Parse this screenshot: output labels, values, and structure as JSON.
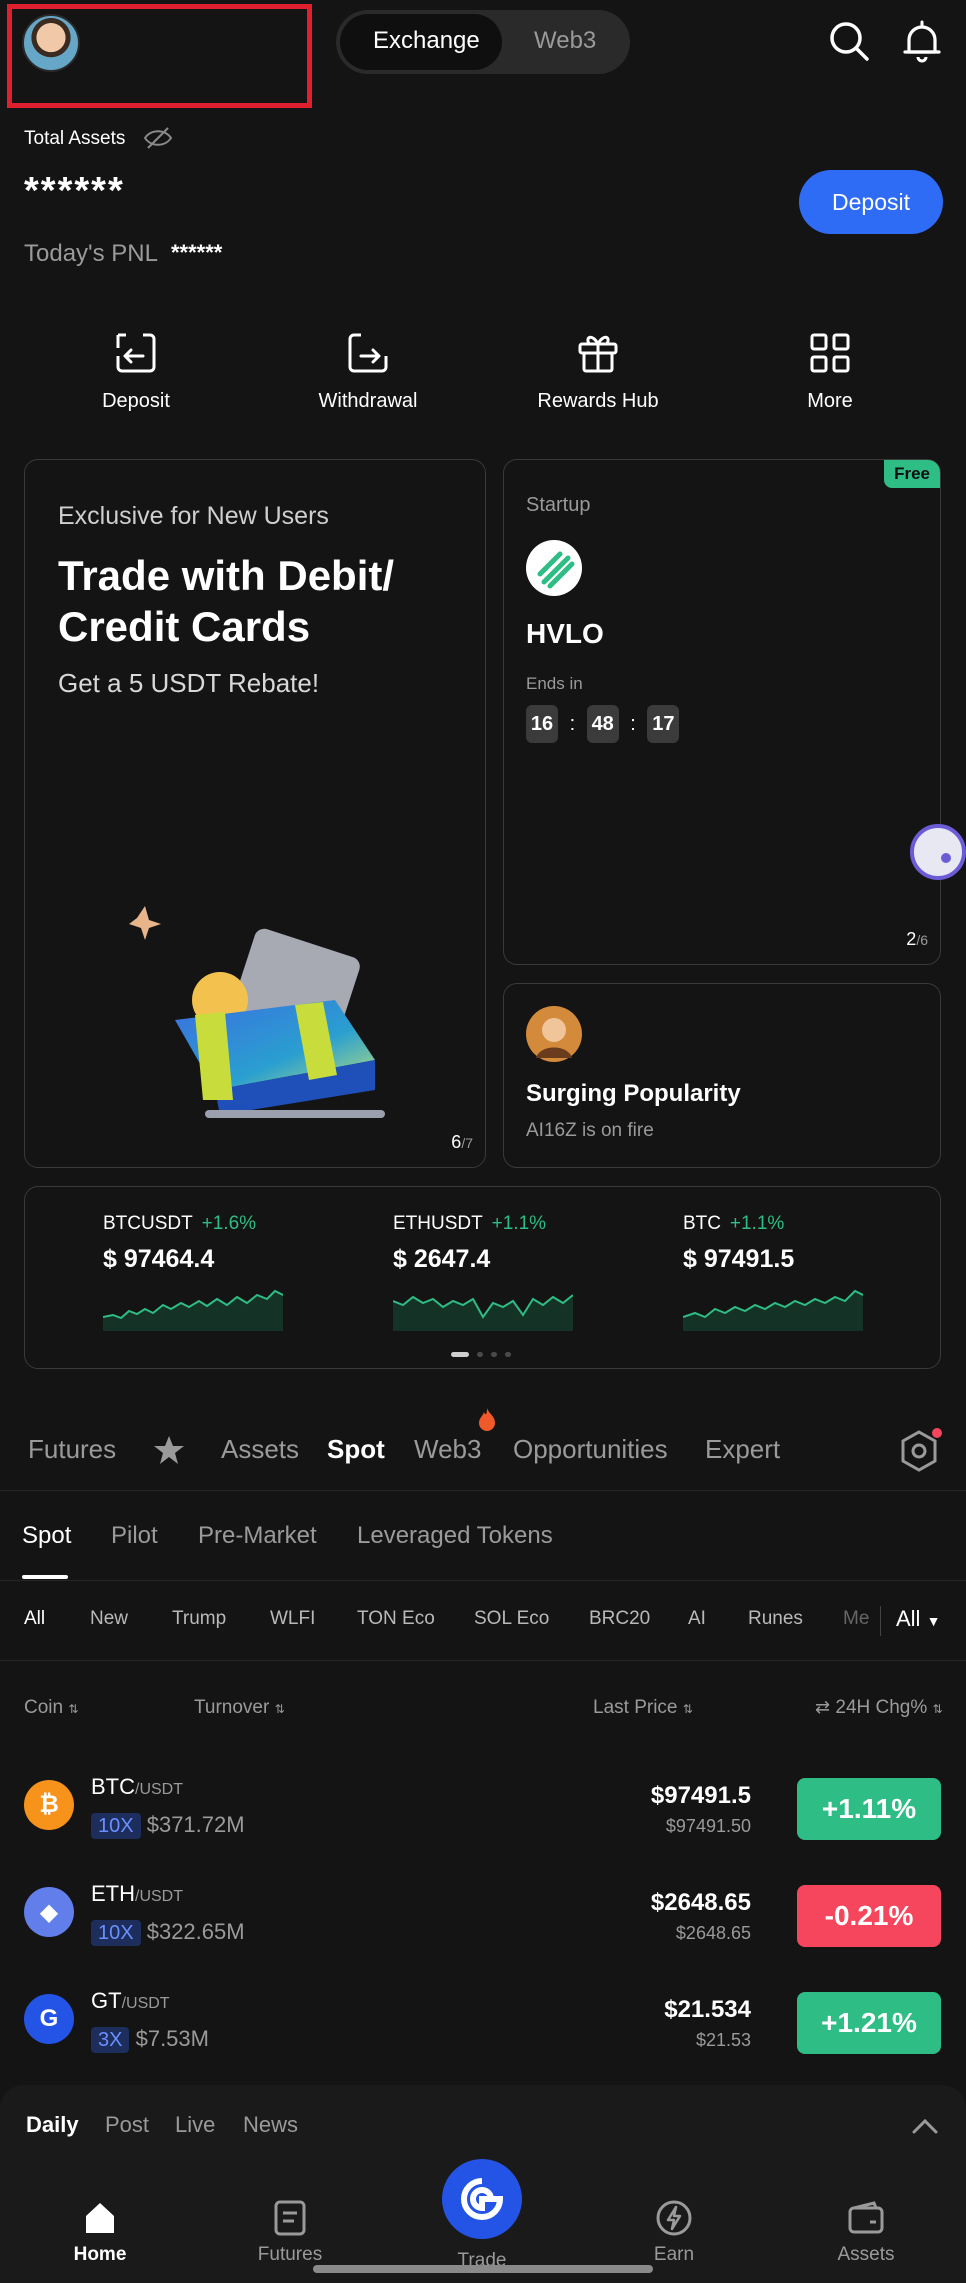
{
  "header": {
    "toggle": {
      "exchange": "Exchange",
      "web3": "Web3"
    }
  },
  "assets": {
    "label": "Total Assets",
    "value": "******",
    "pnl_label": "Today's PNL",
    "pnl_value": "******",
    "deposit_button": "Deposit"
  },
  "quick_actions": [
    {
      "label": "Deposit",
      "icon": "deposit-icon"
    },
    {
      "label": "Withdrawal",
      "icon": "withdrawal-icon"
    },
    {
      "label": "Rewards Hub",
      "icon": "gift-icon"
    },
    {
      "label": "More",
      "icon": "grid-icon"
    }
  ],
  "promo_card": {
    "eyebrow": "Exclusive for New Users",
    "title_line1": "Trade with Debit/",
    "title_line2": "Credit Cards",
    "subtitle": "Get a 5 USDT Rebate!",
    "page_current": "6",
    "page_total": "/7"
  },
  "startup_card": {
    "badge": "Free",
    "label": "Startup",
    "token": "HVLO",
    "ends_label": "Ends in",
    "hours": "16",
    "minutes": "48",
    "seconds": "17",
    "sep": ":",
    "page_current": "2",
    "page_total": "/6"
  },
  "popularity_card": {
    "title": "Surging Popularity",
    "subtitle": "AI16Z is on fire"
  },
  "tickers": [
    {
      "name": "BTCUSDT",
      "change": "+1.6%",
      "price": "$ 97464.4"
    },
    {
      "name": "ETHUSDT",
      "change": "+1.1%",
      "price": "$ 2647.4"
    },
    {
      "name": "BTC",
      "change": "+1.1%",
      "price": "$ 97491.5"
    }
  ],
  "market_tabs": [
    "Futures",
    "Assets",
    "Spot",
    "Web3",
    "Opportunities",
    "Expert"
  ],
  "sub_tabs": [
    "Spot",
    "Pilot",
    "Pre-Market",
    "Leveraged Tokens"
  ],
  "chips": [
    "All",
    "New",
    "Trump",
    "WLFI",
    "TON Eco",
    "SOL Eco",
    "BRC20",
    "AI",
    "Runes",
    "Me"
  ],
  "chips_all": "All",
  "table_headers": {
    "coin": "Coin",
    "turnover": "Turnover",
    "last_price": "Last Price",
    "change": "24H Chg%"
  },
  "rows": [
    {
      "symbol": "BTC",
      "pair": "/USDT",
      "leverage": "10X",
      "turnover": "$371.72M",
      "price": "$97491.5",
      "sub_price": "$97491.50",
      "change": "+1.11%",
      "direction": "up",
      "icon_color": "#f7931a",
      "icon_glyph": "₿"
    },
    {
      "symbol": "ETH",
      "pair": "/USDT",
      "leverage": "10X",
      "turnover": "$322.65M",
      "price": "$2648.65",
      "sub_price": "$2648.65",
      "change": "-0.21%",
      "direction": "down",
      "icon_color": "#627eea",
      "icon_glyph": "◆"
    },
    {
      "symbol": "GT",
      "pair": "/USDT",
      "leverage": "3X",
      "turnover": "$7.53M",
      "price": "$21.534",
      "sub_price": "$21.53",
      "change": "+1.21%",
      "direction": "up",
      "icon_color": "#2354e6",
      "icon_glyph": "G"
    }
  ],
  "feed_tabs": [
    "Daily",
    "Post",
    "Live",
    "News"
  ],
  "bottom_nav": [
    "Home",
    "Futures",
    "Trade",
    "Earn",
    "Assets"
  ],
  "colors": {
    "up": "#2ebd85",
    "down": "#f6465d",
    "accent": "#2f6cf6"
  }
}
